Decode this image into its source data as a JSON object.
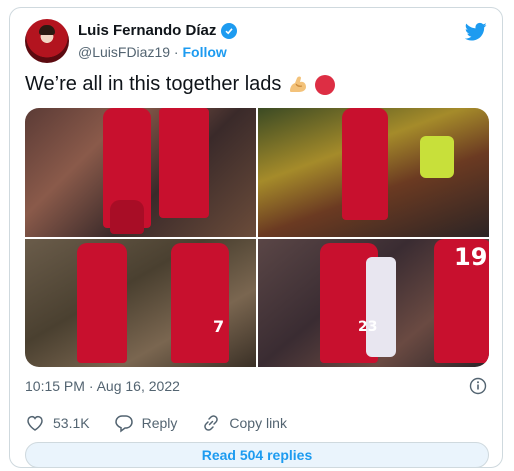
{
  "author": {
    "name": "Luis Fernando Díaz",
    "handle": "@LuisFDiaz19",
    "separator": "·",
    "follow_label": "Follow"
  },
  "tweet": {
    "text": "We’re all in this together lads",
    "emojis": [
      "flexed-biceps",
      "red-circle"
    ],
    "timestamp": "10:15 PM · Aug 16, 2022"
  },
  "media": {
    "photos": [
      {
        "jersey_number": ""
      },
      {
        "jersey_number": ""
      },
      {
        "jersey_number": "7"
      },
      {
        "jersey_number": "23"
      }
    ],
    "extra_number": "19"
  },
  "actions": {
    "like_count": "53.1K",
    "reply_label": "Reply",
    "copy_link_label": "Copy link"
  },
  "footer": {
    "read_replies_label": "Read 504 replies"
  },
  "colors": {
    "accent": "#1d9bf0",
    "text": "#0f1419",
    "muted": "#536471",
    "border": "#cfd9de",
    "jersey": "#c8102e"
  }
}
